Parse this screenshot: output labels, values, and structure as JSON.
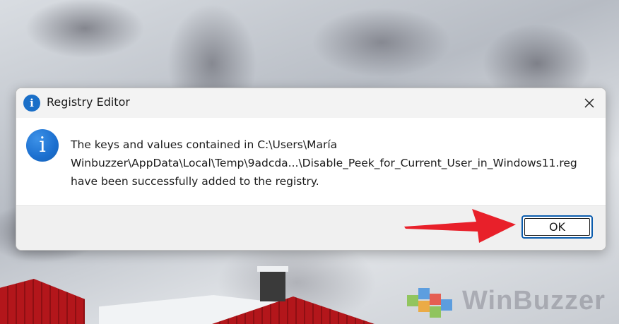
{
  "dialog": {
    "title": "Registry Editor",
    "title_icon": "info-icon",
    "close_icon": "close-icon",
    "message": "The keys and values contained in C:\\Users\\María\nWinbuzzer\\AppData\\Local\\Temp\\9adcda...\\Disable_Peek_for_Current_User_in_Windows11.reg\nhave been successfully added to the registry.",
    "message_icon": "info-icon",
    "ok_label": "OK"
  },
  "annotation": {
    "arrow_icon": "red-arrow-icon",
    "arrow_color": "#e8202a"
  },
  "watermark": {
    "text": "WinBuzzer"
  },
  "colors": {
    "accent": "#0b5cad",
    "info_blue": "#1a6fc8",
    "titlebar": "#f3f3f3",
    "footer": "#f0f0f0"
  }
}
